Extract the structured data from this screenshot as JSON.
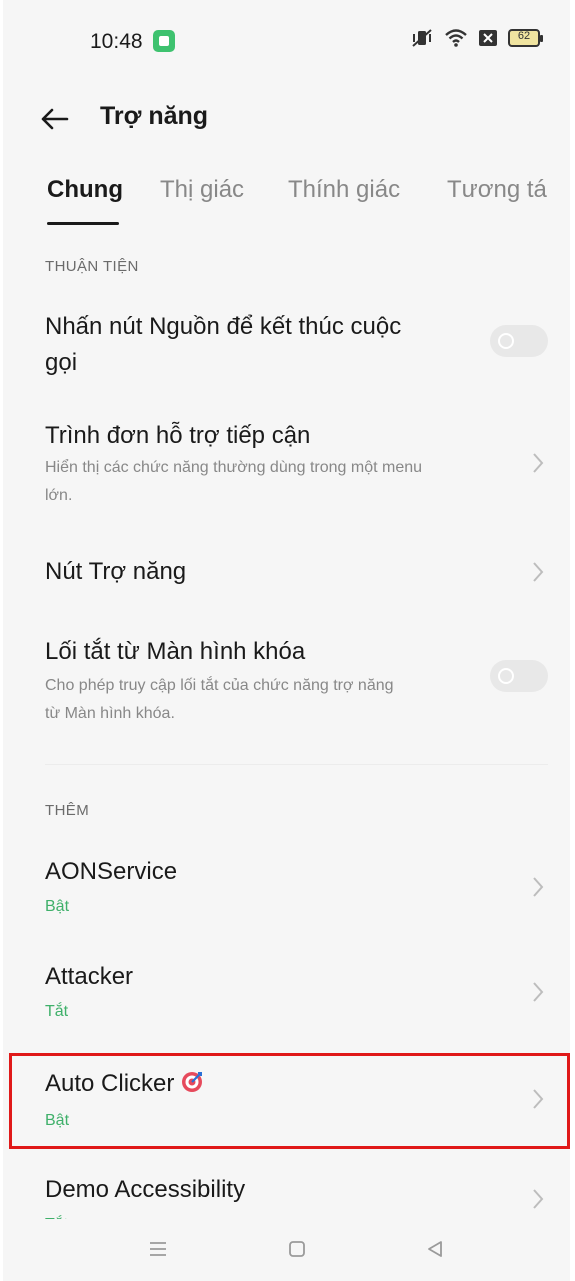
{
  "status_bar": {
    "time": "10:48",
    "battery": "62"
  },
  "header": {
    "title": "Trợ năng"
  },
  "tabs": [
    {
      "label": "Chung",
      "active": true
    },
    {
      "label": "Thị giác",
      "active": false
    },
    {
      "label": "Thính giác",
      "active": false
    },
    {
      "label": "Tương tá",
      "active": false
    }
  ],
  "sections": {
    "convenience": {
      "header": "THUẬN TIỆN",
      "items": [
        {
          "title_line1": "Nhấn nút Nguồn để kết thúc cuộc",
          "title_line2": "gọi",
          "control": "toggle",
          "on": false
        },
        {
          "title": "Trình đơn hỗ trợ tiếp cận",
          "subtitle_line1": "Hiển thị các chức năng thường dùng trong một menu",
          "subtitle_line2": "lớn.",
          "control": "chevron"
        },
        {
          "title": "Nút Trợ năng",
          "control": "chevron"
        },
        {
          "title": "Lối tắt từ Màn hình khóa",
          "subtitle_line1": "Cho phép truy cập lối tắt của chức năng trợ năng",
          "subtitle_line2": "từ Màn hình khóa.",
          "control": "toggle",
          "on": false
        }
      ]
    },
    "more": {
      "header": "THÊM",
      "items": [
        {
          "title": "AONService",
          "status": "Bật",
          "control": "chevron"
        },
        {
          "title": "Attacker",
          "status": "Tắt",
          "control": "chevron"
        },
        {
          "title": "Auto Clicker",
          "status": "Bật",
          "control": "chevron",
          "icon": "target-icon",
          "highlighted": true
        },
        {
          "title": "Demo Accessibility",
          "status": "Tắt",
          "control": "chevron"
        }
      ]
    }
  },
  "colors": {
    "status_on": "#3fb06a",
    "highlight": "#e01919",
    "background": "#f6f6f6"
  },
  "icons": {
    "back": "arrow-left-icon",
    "chevron": "chevron-right-icon",
    "nav_menu": "menu-icon",
    "nav_home": "home-square-icon",
    "nav_back": "triangle-back-icon"
  }
}
